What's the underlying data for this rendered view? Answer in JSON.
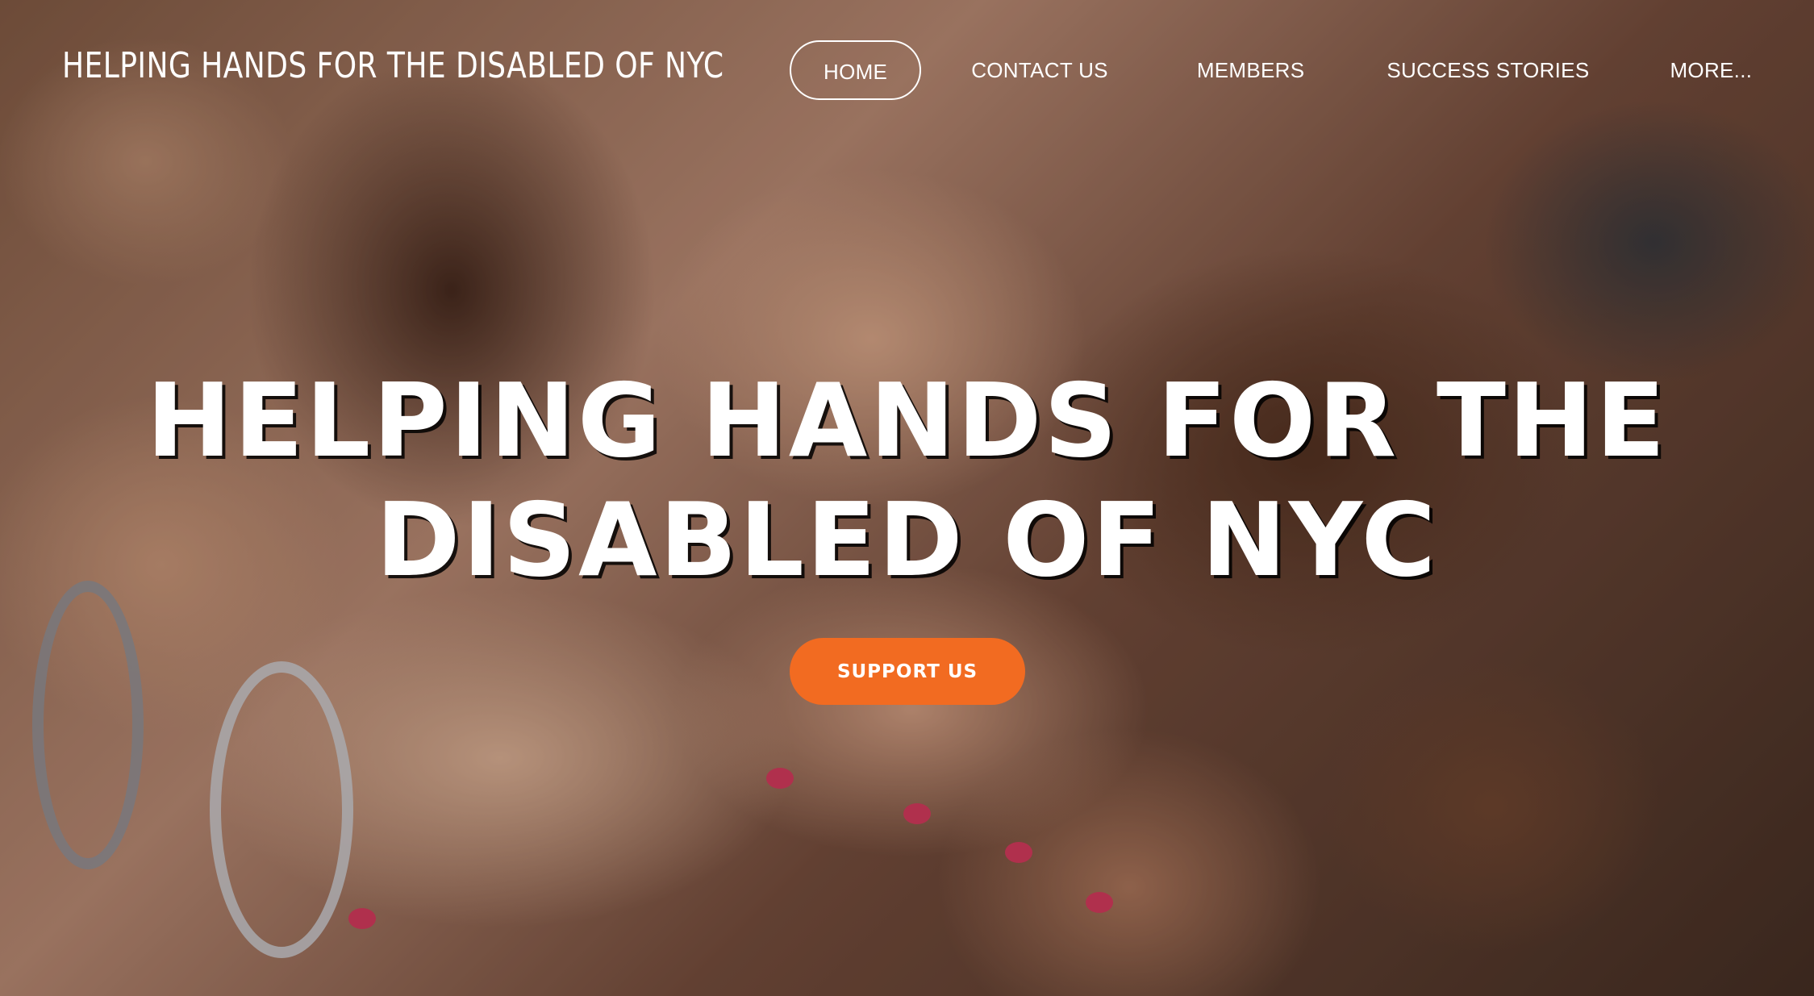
{
  "site": {
    "title": "HELPING HANDS FOR THE DISABLED OF NYC"
  },
  "nav": {
    "items": [
      {
        "label": "HOME",
        "active": true
      },
      {
        "label": "CONTACT US",
        "active": false
      },
      {
        "label": "MEMBERS",
        "active": false
      },
      {
        "label": "SUCCESS STORIES",
        "active": false
      },
      {
        "label": "MORE...",
        "active": false
      }
    ]
  },
  "hero": {
    "heading_line1": "HELPING HANDS FOR THE",
    "heading_line2": "DISABLED OF NYC",
    "cta_label": "SUPPORT US",
    "background_image": "hands stacked together in a circle"
  },
  "colors": {
    "cta": "#f26b21",
    "text": "#ffffff"
  }
}
